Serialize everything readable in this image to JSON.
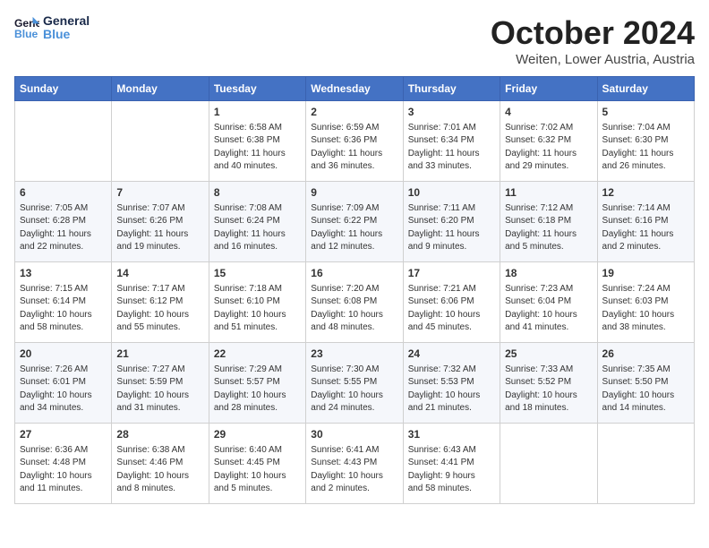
{
  "header": {
    "logo_line1": "General",
    "logo_line2": "Blue",
    "month": "October 2024",
    "location": "Weiten, Lower Austria, Austria"
  },
  "days_of_week": [
    "Sunday",
    "Monday",
    "Tuesday",
    "Wednesday",
    "Thursday",
    "Friday",
    "Saturday"
  ],
  "weeks": [
    [
      {
        "day": "",
        "detail": ""
      },
      {
        "day": "",
        "detail": ""
      },
      {
        "day": "1",
        "detail": "Sunrise: 6:58 AM\nSunset: 6:38 PM\nDaylight: 11 hours\nand 40 minutes."
      },
      {
        "day": "2",
        "detail": "Sunrise: 6:59 AM\nSunset: 6:36 PM\nDaylight: 11 hours\nand 36 minutes."
      },
      {
        "day": "3",
        "detail": "Sunrise: 7:01 AM\nSunset: 6:34 PM\nDaylight: 11 hours\nand 33 minutes."
      },
      {
        "day": "4",
        "detail": "Sunrise: 7:02 AM\nSunset: 6:32 PM\nDaylight: 11 hours\nand 29 minutes."
      },
      {
        "day": "5",
        "detail": "Sunrise: 7:04 AM\nSunset: 6:30 PM\nDaylight: 11 hours\nand 26 minutes."
      }
    ],
    [
      {
        "day": "6",
        "detail": "Sunrise: 7:05 AM\nSunset: 6:28 PM\nDaylight: 11 hours\nand 22 minutes."
      },
      {
        "day": "7",
        "detail": "Sunrise: 7:07 AM\nSunset: 6:26 PM\nDaylight: 11 hours\nand 19 minutes."
      },
      {
        "day": "8",
        "detail": "Sunrise: 7:08 AM\nSunset: 6:24 PM\nDaylight: 11 hours\nand 16 minutes."
      },
      {
        "day": "9",
        "detail": "Sunrise: 7:09 AM\nSunset: 6:22 PM\nDaylight: 11 hours\nand 12 minutes."
      },
      {
        "day": "10",
        "detail": "Sunrise: 7:11 AM\nSunset: 6:20 PM\nDaylight: 11 hours\nand 9 minutes."
      },
      {
        "day": "11",
        "detail": "Sunrise: 7:12 AM\nSunset: 6:18 PM\nDaylight: 11 hours\nand 5 minutes."
      },
      {
        "day": "12",
        "detail": "Sunrise: 7:14 AM\nSunset: 6:16 PM\nDaylight: 11 hours\nand 2 minutes."
      }
    ],
    [
      {
        "day": "13",
        "detail": "Sunrise: 7:15 AM\nSunset: 6:14 PM\nDaylight: 10 hours\nand 58 minutes."
      },
      {
        "day": "14",
        "detail": "Sunrise: 7:17 AM\nSunset: 6:12 PM\nDaylight: 10 hours\nand 55 minutes."
      },
      {
        "day": "15",
        "detail": "Sunrise: 7:18 AM\nSunset: 6:10 PM\nDaylight: 10 hours\nand 51 minutes."
      },
      {
        "day": "16",
        "detail": "Sunrise: 7:20 AM\nSunset: 6:08 PM\nDaylight: 10 hours\nand 48 minutes."
      },
      {
        "day": "17",
        "detail": "Sunrise: 7:21 AM\nSunset: 6:06 PM\nDaylight: 10 hours\nand 45 minutes."
      },
      {
        "day": "18",
        "detail": "Sunrise: 7:23 AM\nSunset: 6:04 PM\nDaylight: 10 hours\nand 41 minutes."
      },
      {
        "day": "19",
        "detail": "Sunrise: 7:24 AM\nSunset: 6:03 PM\nDaylight: 10 hours\nand 38 minutes."
      }
    ],
    [
      {
        "day": "20",
        "detail": "Sunrise: 7:26 AM\nSunset: 6:01 PM\nDaylight: 10 hours\nand 34 minutes."
      },
      {
        "day": "21",
        "detail": "Sunrise: 7:27 AM\nSunset: 5:59 PM\nDaylight: 10 hours\nand 31 minutes."
      },
      {
        "day": "22",
        "detail": "Sunrise: 7:29 AM\nSunset: 5:57 PM\nDaylight: 10 hours\nand 28 minutes."
      },
      {
        "day": "23",
        "detail": "Sunrise: 7:30 AM\nSunset: 5:55 PM\nDaylight: 10 hours\nand 24 minutes."
      },
      {
        "day": "24",
        "detail": "Sunrise: 7:32 AM\nSunset: 5:53 PM\nDaylight: 10 hours\nand 21 minutes."
      },
      {
        "day": "25",
        "detail": "Sunrise: 7:33 AM\nSunset: 5:52 PM\nDaylight: 10 hours\nand 18 minutes."
      },
      {
        "day": "26",
        "detail": "Sunrise: 7:35 AM\nSunset: 5:50 PM\nDaylight: 10 hours\nand 14 minutes."
      }
    ],
    [
      {
        "day": "27",
        "detail": "Sunrise: 6:36 AM\nSunset: 4:48 PM\nDaylight: 10 hours\nand 11 minutes."
      },
      {
        "day": "28",
        "detail": "Sunrise: 6:38 AM\nSunset: 4:46 PM\nDaylight: 10 hours\nand 8 minutes."
      },
      {
        "day": "29",
        "detail": "Sunrise: 6:40 AM\nSunset: 4:45 PM\nDaylight: 10 hours\nand 5 minutes."
      },
      {
        "day": "30",
        "detail": "Sunrise: 6:41 AM\nSunset: 4:43 PM\nDaylight: 10 hours\nand 2 minutes."
      },
      {
        "day": "31",
        "detail": "Sunrise: 6:43 AM\nSunset: 4:41 PM\nDaylight: 9 hours\nand 58 minutes."
      },
      {
        "day": "",
        "detail": ""
      },
      {
        "day": "",
        "detail": ""
      }
    ]
  ]
}
